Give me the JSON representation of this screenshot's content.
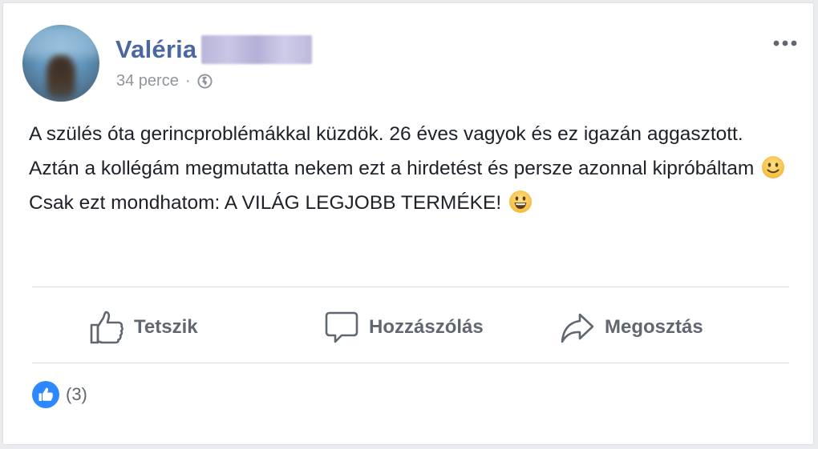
{
  "post": {
    "author_first_name": "Valéria",
    "author_last_name_redacted": true,
    "timestamp": "34 perce",
    "separator": "·",
    "privacy_icon": "globe-icon",
    "menu_icon": "more-dots-icon",
    "text_segments": {
      "part1": "A szülés óta gerincproblémákkal küzdök. 26 éves vagyok és ez igazán aggasztott. Aztán a kollégám megmutatta nekem ezt a hirdetést és persze azonnal kipróbáltam",
      "part2": " Csak ezt mondhatom: A VILÁG LEGJOBB TERMÉKE!"
    },
    "emojis": [
      "slight-smile-emoji",
      "grin-emoji"
    ]
  },
  "actions": {
    "like_label": "Tetszik",
    "comment_label": "Hozzászólás",
    "share_label": "Megosztás"
  },
  "reactions": {
    "count_text": "(3)",
    "icon": "like-thumb-icon"
  },
  "colors": {
    "name": "#4b67a1",
    "meta": "#90949c",
    "text": "#1d2129",
    "action_text": "#606770",
    "like_badge": "#2d88ff",
    "divider": "#dadde1"
  }
}
